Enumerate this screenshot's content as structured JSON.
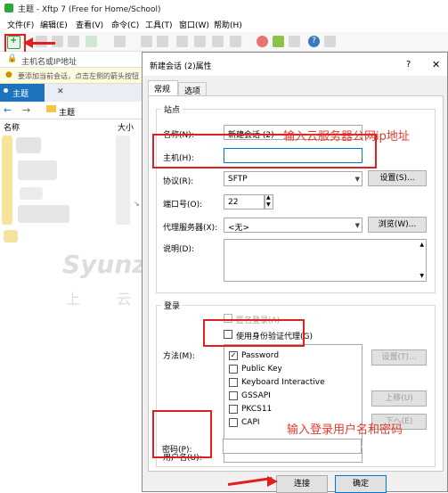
{
  "window": {
    "title": "主题 - Xftp 7 (Free for Home/School)"
  },
  "menu": [
    "文件(F)",
    "编辑(E)",
    "查看(V)",
    "命令(C)",
    "工具(T)",
    "窗口(W)",
    "帮助(H)"
  ],
  "address_bar": {
    "placeholder": "主机名或IP地址"
  },
  "info_bar": {
    "text": "要添加当前会话，点击左侧的箭头按钮"
  },
  "left_pane": {
    "tab_label": "主题",
    "path": "主题",
    "columns": {
      "name": "名称",
      "size": "大小"
    }
  },
  "watermark": {
    "logo": "Syunz.com",
    "sub": "上 云 教 程"
  },
  "dialog": {
    "title": "新建会话 (2)属性",
    "help": "?",
    "close": "✕",
    "tabs": [
      "常规",
      "选项"
    ],
    "site_group": "站点",
    "name_label": "名称(N):",
    "name_value": "新建会话 (2)",
    "host_label": "主机(H):",
    "host_value": "",
    "protocol_label": "协议(R):",
    "protocol_value": "SFTP",
    "settings_button": "设置(S)...",
    "port_label": "端口号(O):",
    "port_value": "22",
    "proxy_label": "代理服务器(X):",
    "proxy_value": "<无>",
    "browse_button": "浏览(W)...",
    "desc_label": "说明(D):",
    "login_group": "登录",
    "anonymous_label": "匿名登录(A)",
    "agent_label": "使用身份验证代理(G)",
    "method_label": "方法(M):",
    "methods": [
      {
        "label": "Password",
        "checked": true
      },
      {
        "label": "Public Key",
        "checked": false
      },
      {
        "label": "Keyboard Interactive",
        "checked": false
      },
      {
        "label": "GSSAPI",
        "checked": false
      },
      {
        "label": "PKCS11",
        "checked": false
      },
      {
        "label": "CAPI",
        "checked": false
      }
    ],
    "method_settings_button": "设置(T)...",
    "up_button": "上移(U)",
    "down_button": "下へ(E)",
    "username_label": "用户名(U):",
    "username_value": "",
    "password_label": "密码(P):",
    "password_value": "",
    "connect_button": "连接",
    "ok_button": "确定"
  },
  "annotations": {
    "host_hint": "输入云服务器公网ip地址",
    "login_hint": "输入登录用户名和密码"
  },
  "colors": {
    "annotation_red": "#e02020",
    "tab_blue": "#1e73be",
    "dialog_bg": "#f0f0f0"
  }
}
